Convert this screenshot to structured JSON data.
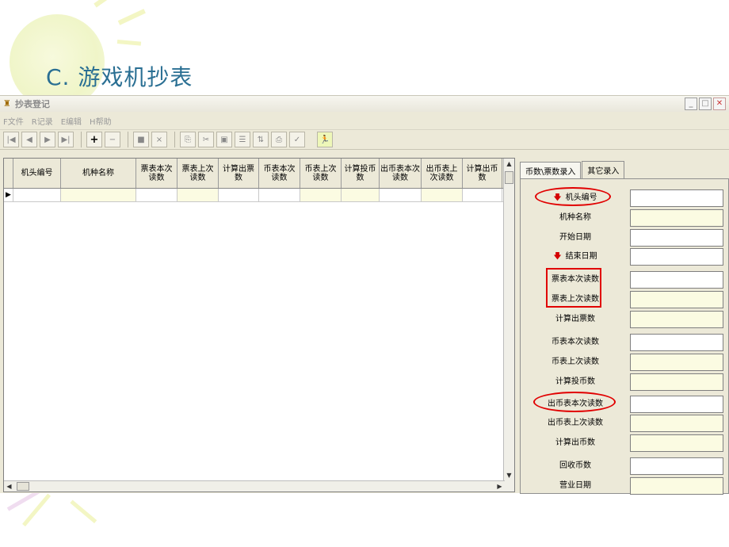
{
  "slide": {
    "title_prefix": "C.",
    "title_text": "游戏机抄表"
  },
  "window": {
    "title": "抄表登记"
  },
  "menu": [
    {
      "key": "F",
      "label": "文件"
    },
    {
      "key": "R",
      "label": "记录"
    },
    {
      "key": "E",
      "label": "编辑"
    },
    {
      "key": "H",
      "label": "帮助"
    }
  ],
  "toolbar": {
    "buttons": [
      "first-record",
      "prev-record",
      "next-record",
      "last-record",
      "insert",
      "delete",
      "post",
      "cancel",
      "copy",
      "cut",
      "paste",
      "properties",
      "transfer",
      "print",
      "check",
      "exit"
    ],
    "insert_label": "+",
    "delete_label": "−",
    "cancel_label": "×"
  },
  "grid": {
    "columns": [
      "机头编号",
      "机种名称",
      "票表本次读数",
      "票表上次读数",
      "计算出票数",
      "币表本次读数",
      "币表上次读数",
      "计算投币数",
      "出币表本次读数",
      "出币表上次读数",
      "计算出币数"
    ],
    "current_row_marker": "▶"
  },
  "panel": {
    "tabs": [
      "币数\\票数录入",
      "其它录入"
    ],
    "fields": [
      {
        "label": "机头编号",
        "arrow": true
      },
      {
        "label": "机种名称"
      },
      {
        "label": "开始日期"
      },
      {
        "label": "结束日期",
        "arrow": true
      },
      {
        "label": "票表本次读数"
      },
      {
        "label": "票表上次读数"
      },
      {
        "label": "计算出票数"
      },
      {
        "label": "币表本次读数"
      },
      {
        "label": "币表上次读数"
      },
      {
        "label": "计算投币数"
      },
      {
        "label": "出币表本次读数"
      },
      {
        "label": "出币表上次读数"
      },
      {
        "label": "计算出币数"
      },
      {
        "label": "回收币数"
      },
      {
        "label": "营业日期"
      }
    ]
  },
  "annotation_color": "#e10000"
}
